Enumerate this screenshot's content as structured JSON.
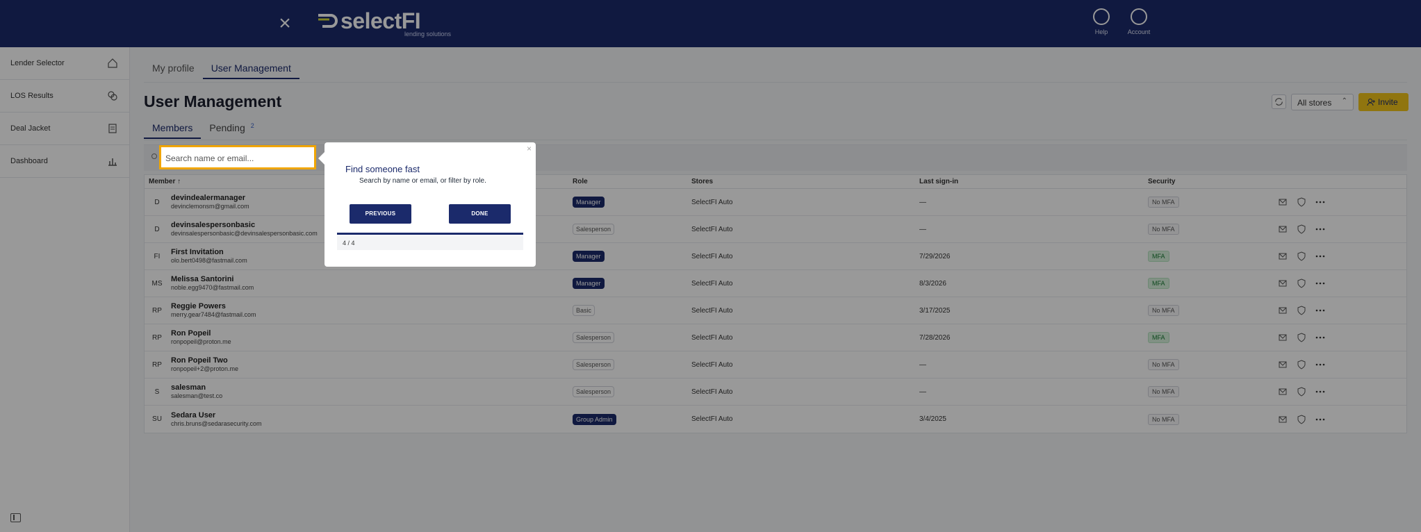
{
  "app": {
    "brand_name": "selectFI",
    "brand_tagline": "lending solutions",
    "help_label": "Help",
    "account_label": "Account"
  },
  "sidebar": {
    "items": [
      {
        "label": "Lender Selector",
        "icon": "home-icon"
      },
      {
        "label": "LOS Results",
        "icon": "coins-icon"
      },
      {
        "label": "Deal Jacket",
        "icon": "document-icon"
      },
      {
        "label": "Dashboard",
        "icon": "chart-icon"
      }
    ]
  },
  "main": {
    "top_tabs": [
      "My profile",
      "User Management"
    ],
    "title": "User Management",
    "store_select": "All stores",
    "invite_label": "Invite",
    "sub_tabs": {
      "members": "Members",
      "pending": "Pending",
      "pending_count": "2"
    },
    "search_placeholder": "Search name or email..."
  },
  "table": {
    "headers": {
      "member": "Member ↑",
      "role": "Role",
      "stores": "Stores",
      "signin": "Last sign-in",
      "security": "Security"
    },
    "rows": [
      {
        "initials": "D",
        "name": "devindealermanager",
        "email": "devinclemonsm@gmail.com",
        "role": "Manager",
        "role_dark": true,
        "store": "SelectFI Auto",
        "signin": "—",
        "security": "No MFA",
        "mfa": false
      },
      {
        "initials": "D",
        "name": "devinsalespersonbasic",
        "email": "devinsalespersonbasic@devinsalespersonbasic.com",
        "role": "Salesperson",
        "role_dark": false,
        "store": "SelectFI Auto",
        "signin": "—",
        "security": "No MFA",
        "mfa": false
      },
      {
        "initials": "FI",
        "name": "First Invitation",
        "email": "olo.bert0498@fastmail.com",
        "role": "Manager",
        "role_dark": true,
        "store": "SelectFI Auto",
        "signin": "7/29/2026",
        "security": "MFA",
        "mfa": true
      },
      {
        "initials": "MS",
        "name": "Melissa Santorini",
        "email": "noble.egg9470@fastmail.com",
        "role": "Manager",
        "role_dark": true,
        "store": "SelectFI Auto",
        "signin": "8/3/2026",
        "security": "MFA",
        "mfa": true
      },
      {
        "initials": "RP",
        "name": "Reggie Powers",
        "email": "merry.gear7484@fastmail.com",
        "role": "Basic",
        "role_dark": false,
        "store": "SelectFI Auto",
        "signin": "3/17/2025",
        "security": "No MFA",
        "mfa": false
      },
      {
        "initials": "RP",
        "name": "Ron Popeil",
        "email": "ronpopeil@proton.me",
        "role": "Salesperson",
        "role_dark": false,
        "store": "SelectFI Auto",
        "signin": "7/28/2026",
        "security": "MFA",
        "mfa": true
      },
      {
        "initials": "RP",
        "name": "Ron Popeil Two",
        "email": "ronpopeil+2@proton.me",
        "role": "Salesperson",
        "role_dark": false,
        "store": "SelectFI Auto",
        "signin": "—",
        "security": "No MFA",
        "mfa": false
      },
      {
        "initials": "S",
        "name": "salesman",
        "email": "salesman@test.co",
        "role": "Salesperson",
        "role_dark": false,
        "store": "SelectFI Auto",
        "signin": "—",
        "security": "No MFA",
        "mfa": false
      },
      {
        "initials": "SU",
        "name": "Sedara User",
        "email": "chris.bruns@sedarasecurity.com",
        "role": "Group Admin",
        "role_dark": true,
        "store": "SelectFI Auto",
        "signin": "3/4/2025",
        "security": "No MFA",
        "mfa": false
      }
    ]
  },
  "tour": {
    "title": "Find someone fast",
    "text": "Search by name or email, or filter by role.",
    "previous": "PREVIOUS",
    "done": "DONE",
    "step": "4 / 4",
    "close": "×"
  }
}
